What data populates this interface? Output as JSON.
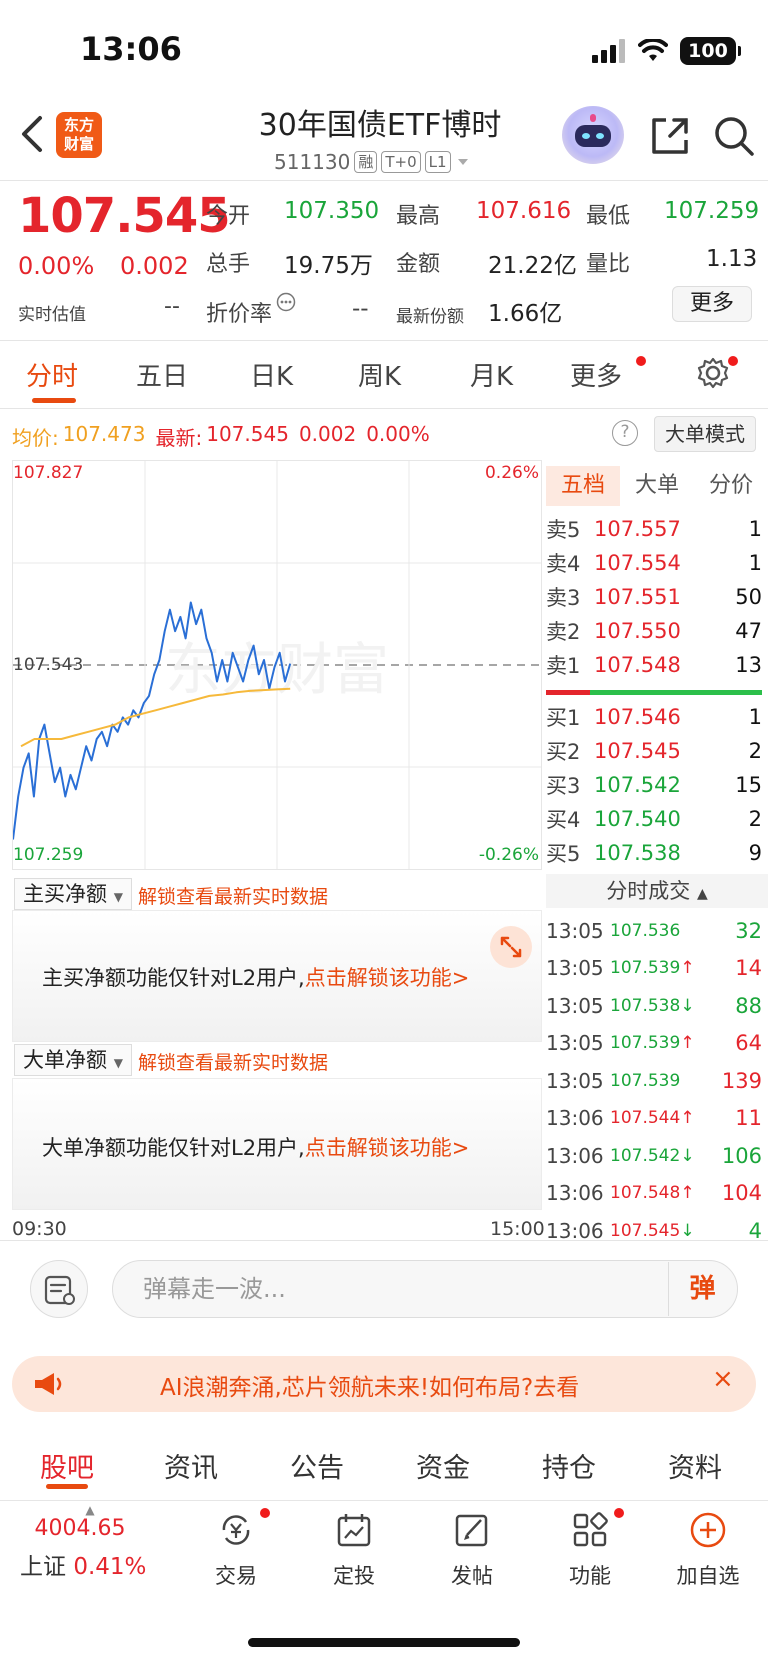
{
  "status": {
    "time": "13:06",
    "battery": "100"
  },
  "header": {
    "logo_line1": "东方",
    "logo_line2": "财富",
    "title": "30年国债ETF博时",
    "code": "511130",
    "tag_rong": "融",
    "tag_t0": "T+0",
    "tag_l1": "L1"
  },
  "quote": {
    "price": "107.545",
    "change_pct": "0.00%",
    "change": "0.002",
    "est_label": "实时估值",
    "est_value": "--",
    "open_label": "今开",
    "open": "107.350",
    "high_label": "最高",
    "high": "107.616",
    "low_label": "最低",
    "low": "107.259",
    "volume_label": "总手",
    "volume": "19.75万",
    "amount_label": "金额",
    "amount": "21.22亿",
    "ratio_label": "量比",
    "ratio": "1.13",
    "premium_label": "折价率",
    "premium": "--",
    "shares_label": "最新份额",
    "shares": "1.66亿",
    "more_label": "更多"
  },
  "period_tabs": [
    "分时",
    "五日",
    "日K",
    "周K",
    "月K",
    "更多"
  ],
  "avg_row": {
    "avg_label": "均价:",
    "avg": "107.473",
    "latest_label": "最新:",
    "latest": "107.545",
    "change": "0.002",
    "pct": "0.00%",
    "big_mode": "大单模式",
    "help": "?"
  },
  "chart_data": {
    "type": "line",
    "y_top": "107.827",
    "y_mid": "107.543",
    "y_bottom": "107.259",
    "pct_top": "0.26%",
    "pct_bottom": "-0.26%",
    "watermark": "东方财富",
    "ylim": [
      107.259,
      107.827
    ],
    "x_start": "09:30",
    "x_end": "15:00",
    "series": [
      {
        "color": "#2a6fd6",
        "values": [
          107.3,
          107.36,
          107.4,
          107.42,
          107.36,
          107.44,
          107.46,
          107.42,
          107.38,
          107.4,
          107.36,
          107.39,
          107.37,
          107.4,
          107.43,
          107.41,
          107.44,
          107.45,
          107.43,
          107.46,
          107.45,
          107.47,
          107.46,
          107.48,
          107.47,
          107.49,
          107.5,
          107.53,
          107.55,
          107.59,
          107.62,
          107.59,
          107.61,
          107.58,
          107.63,
          107.6,
          107.62,
          107.58,
          107.56,
          107.52,
          107.55,
          107.52,
          107.56,
          107.54,
          107.52,
          107.55,
          107.57,
          107.53,
          107.55,
          107.51,
          107.54,
          107.56,
          107.52,
          107.545
        ]
      },
      {
        "color": "#f6b93b",
        "values": [
          107.43,
          107.44,
          107.44,
          107.44,
          107.445,
          107.45,
          107.455,
          107.46,
          107.47,
          107.475,
          107.48,
          107.485,
          107.49,
          107.495,
          107.5,
          107.502,
          107.505,
          107.507,
          107.508,
          107.509,
          107.51
        ]
      }
    ]
  },
  "order_book": {
    "tabs": [
      "五档",
      "大单",
      "分价"
    ],
    "asks": [
      {
        "label": "卖5",
        "price": "107.557",
        "vol": "1"
      },
      {
        "label": "卖4",
        "price": "107.554",
        "vol": "1"
      },
      {
        "label": "卖3",
        "price": "107.551",
        "vol": "50"
      },
      {
        "label": "卖2",
        "price": "107.550",
        "vol": "47"
      },
      {
        "label": "卖1",
        "price": "107.548",
        "vol": "13"
      }
    ],
    "bids": [
      {
        "label": "买1",
        "price": "107.546",
        "vol": "1"
      },
      {
        "label": "买2",
        "price": "107.545",
        "vol": "2"
      },
      {
        "label": "买3",
        "price": "107.542",
        "vol": "15"
      },
      {
        "label": "买4",
        "price": "107.540",
        "vol": "2"
      },
      {
        "label": "买5",
        "price": "107.538",
        "vol": "9"
      }
    ]
  },
  "trades": {
    "title": "分时成交",
    "rows": [
      {
        "time": "13:05",
        "price": "107.536",
        "arrow": "",
        "vol": "32"
      },
      {
        "time": "13:05",
        "price": "107.539",
        "arrow": "↑",
        "vol": "14"
      },
      {
        "time": "13:05",
        "price": "107.538",
        "arrow": "↓",
        "vol": "88"
      },
      {
        "time": "13:05",
        "price": "107.539",
        "arrow": "↑",
        "vol": "64"
      },
      {
        "time": "13:05",
        "price": "107.539",
        "arrow": "",
        "vol": "139"
      },
      {
        "time": "13:06",
        "price": "107.544",
        "arrow": "↑",
        "vol": "11"
      },
      {
        "time": "13:06",
        "price": "107.542",
        "arrow": "↓",
        "vol": "106"
      },
      {
        "time": "13:06",
        "price": "107.548",
        "arrow": "↑",
        "vol": "104"
      },
      {
        "time": "13:06",
        "price": "107.545",
        "arrow": "↓",
        "vol": "4"
      }
    ]
  },
  "panels": {
    "main_label": "主买净额",
    "main_link": "解锁查看最新实时数据",
    "main_text": "主买净额功能仅针对L2用户,",
    "main_action": "点击解锁该功能>",
    "big_label": "大单净额",
    "big_link": "解锁查看最新实时数据",
    "big_text": "大单净额功能仅针对L2用户,",
    "big_action": "点击解锁该功能>"
  },
  "time_axis": {
    "start": "09:30",
    "end": "15:00"
  },
  "danmaku": {
    "placeholder": "弹幕走一波...",
    "send": "弹"
  },
  "banner": {
    "text": "AI浪潮奔涌,芯片领航未来!如何布局?去看",
    "close": "×"
  },
  "bottom_tabs": [
    "股吧",
    "资讯",
    "公告",
    "资金",
    "持仓",
    "资料"
  ],
  "bottom_bar": {
    "index_value": "4004.65",
    "index_name": "上证",
    "index_pct": "0.41%",
    "trade": "交易",
    "fixed": "定投",
    "post": "发帖",
    "function": "功能",
    "add": "加自选"
  }
}
